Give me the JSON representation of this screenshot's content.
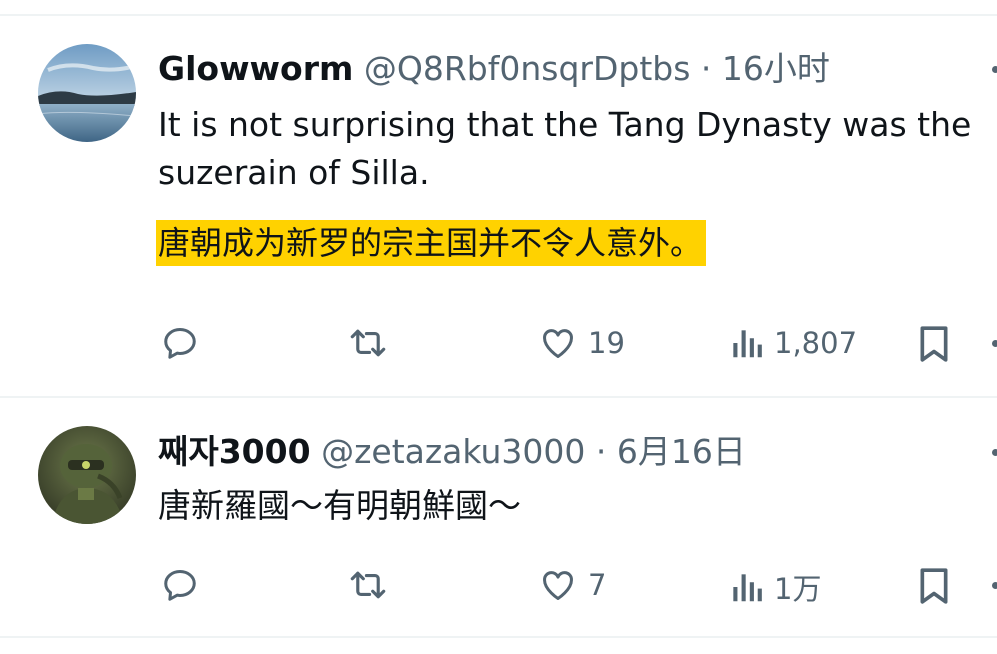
{
  "tweets": [
    {
      "name": "Glowworm",
      "handle": "@Q8Rbf0nsqrDptbs",
      "separator": "·",
      "time": "16小时",
      "text": "It is not surprising that the Tang Dynasty was the suzerain of Silla.",
      "translation": "唐朝成为新罗的宗主国并不令人意外。",
      "highlight_color": "#ffd200",
      "actions": {
        "reply_icon": "reply-icon",
        "retweet_icon": "retweet-icon",
        "like_icon": "heart-icon",
        "likes": "19",
        "views_icon": "analytics-icon",
        "views": "1,807",
        "bookmark_icon": "bookmark-icon"
      }
    },
    {
      "name": "째자3000",
      "handle": "@zetazaku3000",
      "separator": "·",
      "time": "6月16日",
      "text": "唐新羅國〜有明朝鮮國〜",
      "actions": {
        "reply_icon": "reply-icon",
        "retweet_icon": "retweet-icon",
        "like_icon": "heart-icon",
        "likes": "7",
        "views_icon": "analytics-icon",
        "views": "1万",
        "bookmark_icon": "bookmark-icon"
      }
    }
  ],
  "colors": {
    "text_primary": "#0f1419",
    "text_secondary": "#536471",
    "divider": "#eff3f4"
  }
}
